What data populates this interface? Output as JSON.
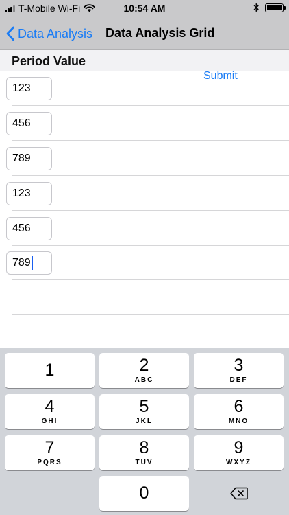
{
  "status_bar": {
    "carrier": "T-Mobile Wi-Fi",
    "time": "10:54 AM"
  },
  "nav": {
    "back_label": "Data Analysis",
    "title": "Data Analysis Grid"
  },
  "section": {
    "header": "Period Value"
  },
  "submit_label": "Submit",
  "rows": [
    {
      "value": "123"
    },
    {
      "value": "456"
    },
    {
      "value": "789"
    },
    {
      "value": "123"
    },
    {
      "value": "456"
    },
    {
      "value": "789",
      "focused": true
    }
  ],
  "keyboard": {
    "keys": [
      {
        "digit": "1",
        "letters": ""
      },
      {
        "digit": "2",
        "letters": "ABC"
      },
      {
        "digit": "3",
        "letters": "DEF"
      },
      {
        "digit": "4",
        "letters": "GHI"
      },
      {
        "digit": "5",
        "letters": "JKL"
      },
      {
        "digit": "6",
        "letters": "MNO"
      },
      {
        "digit": "7",
        "letters": "PQRS"
      },
      {
        "digit": "8",
        "letters": "TUV"
      },
      {
        "digit": "9",
        "letters": "WXYZ"
      },
      {
        "digit": "0",
        "letters": ""
      }
    ],
    "delete_icon": "delete-backward-icon"
  },
  "colors": {
    "accent": "#1a7cf5",
    "bar_background": "#c9c9cb",
    "keyboard_background": "#d1d4d9"
  }
}
